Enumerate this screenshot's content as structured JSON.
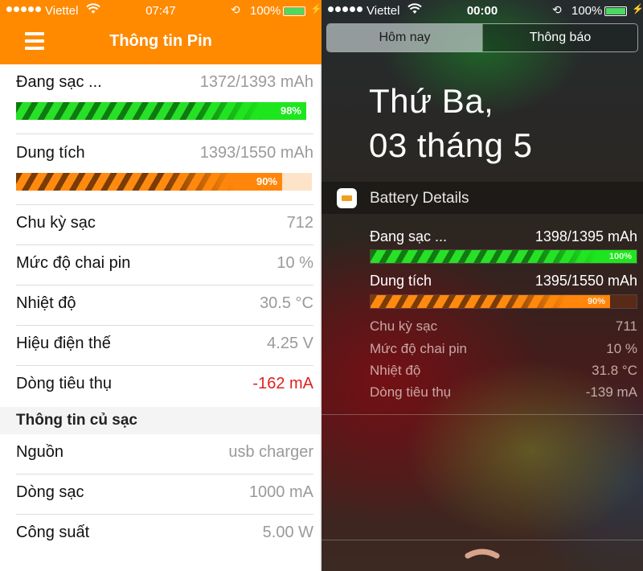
{
  "left_app": {
    "status_bar": {
      "carrier": "Viettel",
      "time": "07:47",
      "battery_percent": "100%",
      "signal_icon": "signal-dots-icon",
      "wifi_icon": "wifi-icon",
      "rotation_lock_icon": "rotation-lock-icon",
      "charging_icon": "bolt-icon"
    },
    "nav": {
      "title": "Thông tin Pin",
      "menu_icon": "hamburger-menu-icon"
    },
    "charging": {
      "label": "Đang sạc ...",
      "value": "1372/1393 mAh",
      "progress_percent": 98,
      "progress_label": "98%",
      "color": "#22e022"
    },
    "capacity": {
      "label": "Dung tích",
      "value": "1393/1550 mAh",
      "progress_percent": 90,
      "progress_label": "90%",
      "color": "#ff860a",
      "track_color": "#fde3c8"
    },
    "rows": [
      {
        "label": "Chu kỳ sạc",
        "value": "712"
      },
      {
        "label": "Mức độ chai pin",
        "value": "10 %"
      },
      {
        "label": "Nhiệt độ",
        "value": "30.5 °C"
      },
      {
        "label": "Hiệu điện thế",
        "value": "4.25 V"
      },
      {
        "label": "Dòng tiêu thụ",
        "value": "-162 mA",
        "value_color": "#e02020"
      }
    ],
    "charger_section": {
      "title": "Thông tin củ sạc",
      "rows": [
        {
          "label": "Nguồn",
          "value": "usb charger"
        },
        {
          "label": "Dòng sạc",
          "value": "1000 mA"
        },
        {
          "label": "Công suất",
          "value": "5.00 W"
        }
      ]
    },
    "accent_color": "#ff8a00"
  },
  "right_app": {
    "status_bar": {
      "carrier": "Viettel",
      "time": "00:00",
      "battery_percent": "100%"
    },
    "tabs": [
      {
        "label": "Hôm nay",
        "active": true
      },
      {
        "label": "Thông báo",
        "active": false
      }
    ],
    "date": {
      "line1": "Thứ Ba,",
      "line2": "03 tháng 5"
    },
    "widget": {
      "title": "Battery Details",
      "icon": "battery-app-icon",
      "charging": {
        "label": "Đang sạc ...",
        "value": "1398/1395 mAh",
        "progress_percent": 100,
        "progress_label": "100%"
      },
      "capacity": {
        "label": "Dung tích",
        "value": "1395/1550 mAh",
        "progress_percent": 90,
        "progress_label": "90%"
      },
      "rows": [
        {
          "label": "Chu kỳ sạc",
          "value": "711"
        },
        {
          "label": "Mức độ chai pin",
          "value": "10 %"
        },
        {
          "label": "Nhiệt độ",
          "value": "31.8 °C"
        },
        {
          "label": "Dòng tiêu thụ",
          "value": "-139 mA"
        }
      ]
    },
    "grabber_icon": "chevron-up-grabber-icon"
  }
}
